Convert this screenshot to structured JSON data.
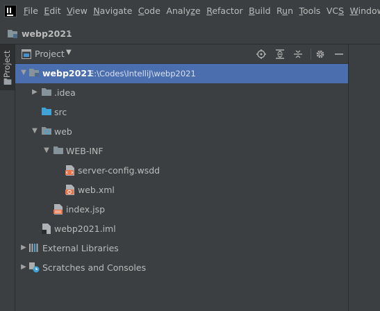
{
  "menu": {
    "items": [
      {
        "pre": "",
        "u": "F",
        "post": "ile"
      },
      {
        "pre": "",
        "u": "E",
        "post": "dit"
      },
      {
        "pre": "",
        "u": "V",
        "post": "iew"
      },
      {
        "pre": "",
        "u": "N",
        "post": "avigate"
      },
      {
        "pre": "",
        "u": "C",
        "post": "ode"
      },
      {
        "pre": "Analy",
        "u": "z",
        "post": "e"
      },
      {
        "pre": "",
        "u": "R",
        "post": "efactor"
      },
      {
        "pre": "",
        "u": "B",
        "post": "uild"
      },
      {
        "pre": "R",
        "u": "u",
        "post": "n"
      },
      {
        "pre": "",
        "u": "T",
        "post": "ools"
      },
      {
        "pre": "VC",
        "u": "S",
        "post": ""
      },
      {
        "pre": "",
        "u": "W",
        "post": "indow"
      }
    ]
  },
  "navbar": {
    "title": "webp2021"
  },
  "stripe": {
    "tab_label": "Project"
  },
  "panel": {
    "title": "Project"
  },
  "tree": {
    "root_name": "webp2021",
    "root_path": "E:\\Codes\\IntelliJ\\webp2021",
    "idea": ".idea",
    "src": "src",
    "web": "web",
    "webinf": "WEB-INF",
    "server_config": "server-config.wsdd",
    "web_xml": "web.xml",
    "index_jsp": "index.jsp",
    "iml": "webp2021.iml",
    "external_libraries": "External Libraries",
    "scratches": "Scratches and Consoles"
  },
  "colors": {
    "background": "#3c3f41",
    "selection": "#4b6eaf",
    "folder": "#87939a",
    "source_folder": "#40a3d8",
    "xml_icon": "#e8754a"
  }
}
